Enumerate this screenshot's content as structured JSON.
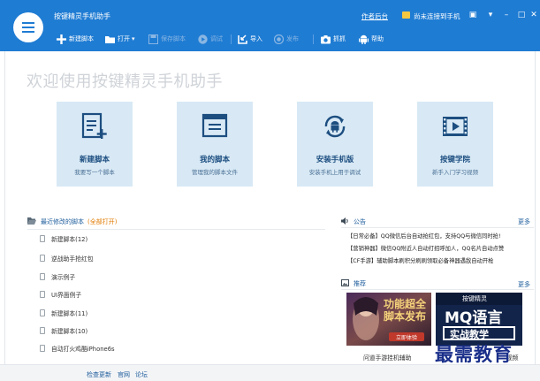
{
  "window": {
    "title": "按键精灵手机助手",
    "author_link": "作者后台",
    "phone_status": "尚未连接到手机"
  },
  "toolbar": {
    "new_script": "新建脚本",
    "open": "打开",
    "save_script": "保存脚本",
    "debug": "调试",
    "import": "导入",
    "publish": "发布",
    "capture": "抓抓",
    "help": "帮助"
  },
  "welcome": "欢迎使用按键精灵手机助手",
  "cards": [
    {
      "name": "新建脚本",
      "desc": "我要写一个脚本",
      "icon": "new-document-icon"
    },
    {
      "name": "我的脚本",
      "desc": "管理我的脚本文件",
      "icon": "script-window-icon"
    },
    {
      "name": "安装手机版",
      "desc": "安装手机上用于调试",
      "icon": "android-sync-icon"
    },
    {
      "name": "按键学院",
      "desc": "新手入门学习视频",
      "icon": "film-play-icon"
    }
  ],
  "recent": {
    "title": "最近修改的脚本",
    "open_all": "(全部打开)",
    "items": [
      "新建脚本(12)",
      "逆战助手抢红包",
      "演示例子",
      "UI界面例子",
      "新建脚本(11)",
      "新建脚本(10)",
      "自动打火鸡酷iPhone6s"
    ]
  },
  "notices": {
    "title": "公告",
    "more": "更多",
    "items": [
      "【日常必备】QQ微信后台自动抢红包，支持QQ与微信同时抢!",
      "【营销神器】微信QQ附近人自动打招呼加人，QQ名片自动点赞",
      "【CF手游】辅助脚本刷积分刷刷领取必备神器遇敌自动开枪"
    ]
  },
  "recommend": {
    "title": "推荐",
    "more": "更多",
    "promo1": "功能超全\n脚本发布",
    "promo1_btn": "立即体验",
    "promo2_top": "按键精灵",
    "promo2_logo": "MQ语言",
    "promo2_sub": "实战教学",
    "caption1": "问道手游挂机辅助",
    "caption2": "视频"
  },
  "footer": {
    "check_update": "检查更新",
    "website": "官网",
    "forum": "论坛"
  },
  "watermark": "最需教育",
  "colors": {
    "titlebar": "#1f7cd3",
    "card_bg": "#d8e9f5",
    "link": "#1e5d9c",
    "accent_orange": "#e27a00"
  }
}
